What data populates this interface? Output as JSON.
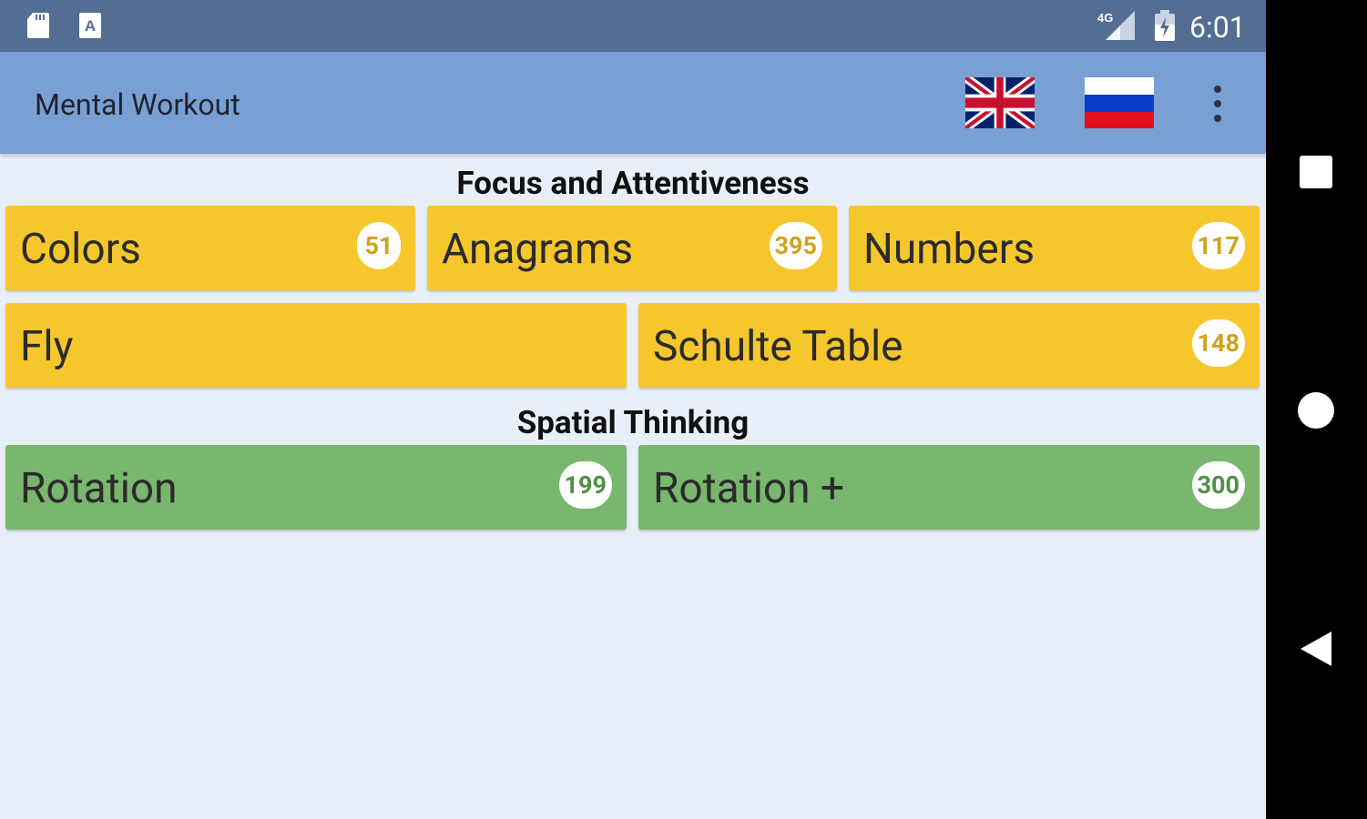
{
  "status_bar": {
    "time": "6:01",
    "network": "4G",
    "icons": [
      "sd-card-icon",
      "a-notification-icon",
      "signal-icon",
      "battery-icon"
    ]
  },
  "app_bar": {
    "title": "Mental Workout",
    "languages": [
      "English",
      "Russian"
    ],
    "menu_icon": "more-vert-icon"
  },
  "sections": [
    {
      "title": "Focus and Attentiveness",
      "color": "#f6c72d",
      "tiles": [
        {
          "label": "Colors",
          "count": "51"
        },
        {
          "label": "Anagrams",
          "count": "395"
        },
        {
          "label": "Numbers",
          "count": "117"
        },
        {
          "label": "Fly",
          "count": ""
        },
        {
          "label": "Schulte Table",
          "count": "148"
        }
      ]
    },
    {
      "title": "Spatial Thinking",
      "color": "#78b76d",
      "tiles": [
        {
          "label": "Rotation",
          "count": "199"
        },
        {
          "label": "Rotation +",
          "count": "300"
        }
      ]
    }
  ],
  "nav_bar": {
    "buttons": [
      "recents-icon",
      "home-icon",
      "back-icon"
    ]
  }
}
